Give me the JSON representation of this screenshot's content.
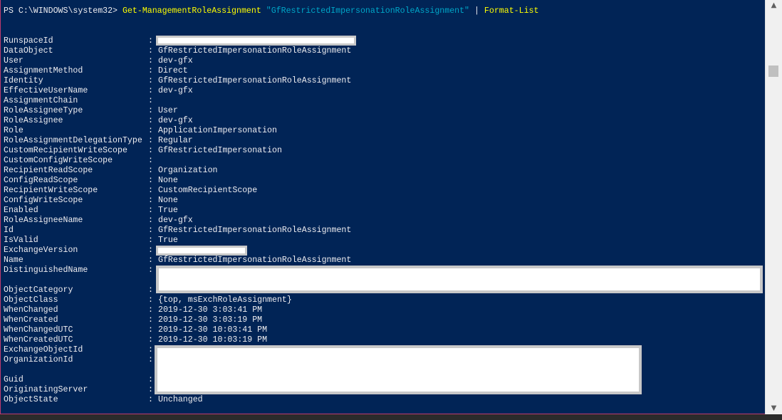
{
  "prompt": "PS C:\\WINDOWS\\system32> ",
  "command": {
    "cmdlet": "Get-ManagementRoleAssignment",
    "argument": "\"GfRestrictedImpersonationRoleAssignment\"",
    "pipe": " | ",
    "formatter": "Format-List"
  },
  "separator": ":",
  "properties": [
    {
      "name": "RunspaceId",
      "value": ""
    },
    {
      "name": "DataObject",
      "value": "GfRestrictedImpersonationRoleAssignment"
    },
    {
      "name": "User",
      "value": "dev-gfx"
    },
    {
      "name": "AssignmentMethod",
      "value": "Direct"
    },
    {
      "name": "Identity",
      "value": "GfRestrictedImpersonationRoleAssignment"
    },
    {
      "name": "EffectiveUserName",
      "value": "dev-gfx"
    },
    {
      "name": "AssignmentChain",
      "value": ""
    },
    {
      "name": "RoleAssigneeType",
      "value": "User"
    },
    {
      "name": "RoleAssignee",
      "value": "dev-gfx"
    },
    {
      "name": "Role",
      "value": "ApplicationImpersonation"
    },
    {
      "name": "RoleAssignmentDelegationType",
      "value": "Regular"
    },
    {
      "name": "CustomRecipientWriteScope",
      "value": "GfRestrictedImpersonation"
    },
    {
      "name": "CustomConfigWriteScope",
      "value": ""
    },
    {
      "name": "RecipientReadScope",
      "value": "Organization"
    },
    {
      "name": "ConfigReadScope",
      "value": "None"
    },
    {
      "name": "RecipientWriteScope",
      "value": "CustomRecipientScope"
    },
    {
      "name": "ConfigWriteScope",
      "value": "None"
    },
    {
      "name": "Enabled",
      "value": "True"
    },
    {
      "name": "RoleAssigneeName",
      "value": "dev-gfx"
    },
    {
      "name": "Id",
      "value": "GfRestrictedImpersonationRoleAssignment"
    },
    {
      "name": "IsValid",
      "value": "True"
    },
    {
      "name": "ExchangeVersion",
      "value": ""
    },
    {
      "name": "Name",
      "value": "GfRestrictedImpersonationRoleAssignment"
    },
    {
      "name": "DistinguishedName",
      "value": ""
    },
    {
      "name": "",
      "value": ""
    },
    {
      "name": "ObjectCategory",
      "value": ""
    },
    {
      "name": "ObjectClass",
      "value": "{top, msExchRoleAssignment}"
    },
    {
      "name": "WhenChanged",
      "value": "2019-12-30 3:03:41 PM"
    },
    {
      "name": "WhenCreated",
      "value": "2019-12-30 3:03:19 PM"
    },
    {
      "name": "WhenChangedUTC",
      "value": "2019-12-30 10:03:41 PM"
    },
    {
      "name": "WhenCreatedUTC",
      "value": "2019-12-30 10:03:19 PM"
    },
    {
      "name": "ExchangeObjectId",
      "value": ""
    },
    {
      "name": "OrganizationId",
      "value": ""
    },
    {
      "name": "",
      "value": ""
    },
    {
      "name": "Guid",
      "value": ""
    },
    {
      "name": "OriginatingServer",
      "value": ""
    },
    {
      "name": "ObjectState",
      "value": "Unchanged"
    }
  ],
  "colors": {
    "background": "#012456",
    "text": "#eeedf0",
    "cmdlet": "#ffff00",
    "string": "#00a6c8"
  },
  "scrollbar": {
    "up_icon": "chevron-up-icon",
    "down_icon": "chevron-down-icon"
  }
}
